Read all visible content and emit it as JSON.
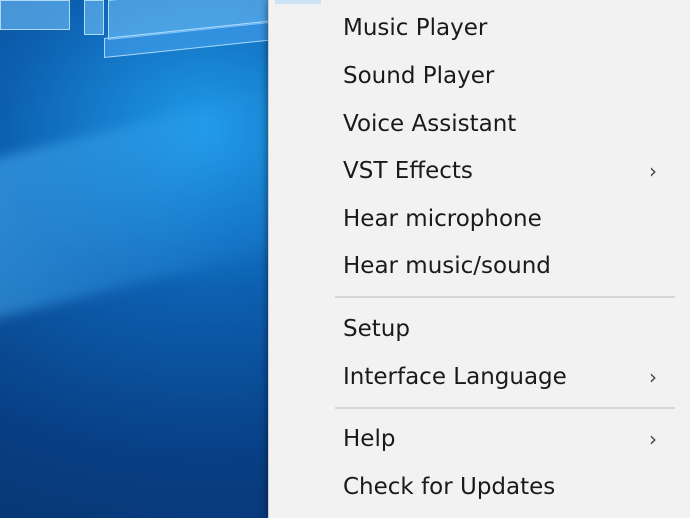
{
  "menu": {
    "group1": [
      {
        "label": "Music Player",
        "has_submenu": false
      },
      {
        "label": "Sound Player",
        "has_submenu": false
      },
      {
        "label": "Voice Assistant",
        "has_submenu": false
      },
      {
        "label": "VST Effects",
        "has_submenu": true
      },
      {
        "label": "Hear microphone",
        "has_submenu": false
      },
      {
        "label": "Hear music/sound",
        "has_submenu": false
      }
    ],
    "group2": [
      {
        "label": "Setup",
        "has_submenu": false
      },
      {
        "label": "Interface Language",
        "has_submenu": true
      }
    ],
    "group3": [
      {
        "label": "Help",
        "has_submenu": true
      },
      {
        "label": "Check for Updates",
        "has_submenu": false
      }
    ],
    "submenu_arrow": "›"
  },
  "colors": {
    "menu_background": "#f2f2f2",
    "separator": "#d6d6d6",
    "text": "#1a1a1a",
    "desktop_blue": "#0d5fb0"
  }
}
